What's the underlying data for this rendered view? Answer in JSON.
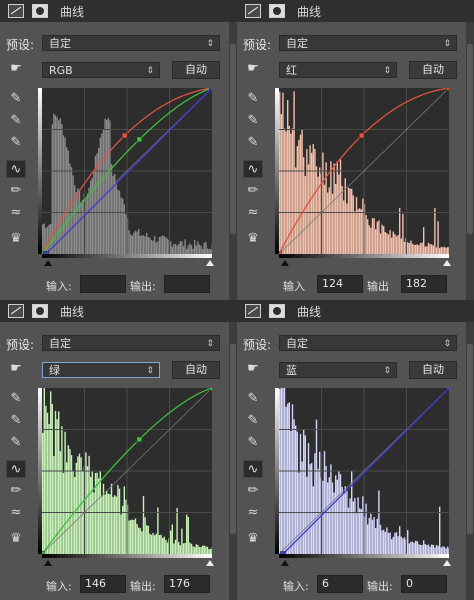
{
  "panels": [
    {
      "header_title": "曲线",
      "preset_label": "预设:",
      "preset_value": "自定",
      "channel": "RGB",
      "auto_label": "自动",
      "input_label": "输入:",
      "output_label": "输出:",
      "input_value": "",
      "output_value": ""
    },
    {
      "header_title": "曲线",
      "preset_label": "预设:",
      "preset_value": "自定",
      "channel": "红",
      "auto_label": "自动",
      "input_label": "输入",
      "output_label": "输出",
      "input_value": "124",
      "output_value": "182"
    },
    {
      "header_title": "曲线",
      "preset_label": "预设:",
      "preset_value": "自定",
      "channel": "绿",
      "auto_label": "自动",
      "input_label": "输入:",
      "output_label": "输出:",
      "input_value": "146",
      "output_value": "176"
    },
    {
      "header_title": "曲线",
      "preset_label": "预设:",
      "preset_value": "自定",
      "channel": "蓝",
      "auto_label": "自动",
      "input_label": "输入:",
      "output_label": "输出:",
      "input_value": "6",
      "output_value": "0"
    }
  ],
  "curves": {
    "red": {
      "color": "#e1533f",
      "points": [
        [
          0,
          0
        ],
        [
          124,
          182
        ],
        [
          255,
          255
        ]
      ]
    },
    "green": {
      "color": "#3cc13c",
      "points": [
        [
          0,
          0
        ],
        [
          146,
          176
        ],
        [
          255,
          255
        ]
      ]
    },
    "blue": {
      "color": "#3b3bd8",
      "points": [
        [
          6,
          0
        ],
        [
          255,
          255
        ]
      ]
    }
  },
  "histogram_colors": {
    "rgb": "#8a8a8a",
    "red": "#f3c1ac",
    "green": "#c8f3b8",
    "blue": "#d5d6fb"
  },
  "icons": [
    "curve-adjust-icon",
    "mask-icon",
    "hand-target-icon",
    "black-eyedropper-icon",
    "gray-eyedropper-icon",
    "white-eyedropper-icon",
    "curve-tool-icon",
    "pencil-icon",
    "smooth-icon",
    "clipping-warning-icon"
  ]
}
